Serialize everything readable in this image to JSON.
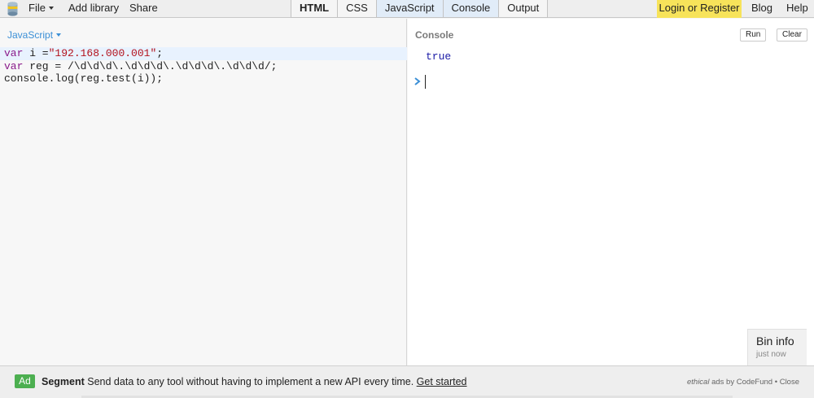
{
  "toolbar": {
    "menu": {
      "file": "File",
      "add_library": "Add library",
      "share": "Share"
    },
    "tabs": [
      {
        "label": "HTML",
        "active": false
      },
      {
        "label": "CSS",
        "active": false
      },
      {
        "label": "JavaScript",
        "active": true
      },
      {
        "label": "Console",
        "active": true
      },
      {
        "label": "Output",
        "active": false
      }
    ],
    "login": "Login or Register",
    "blog": "Blog",
    "help": "Help"
  },
  "editor": {
    "language": "JavaScript",
    "code": {
      "line1": {
        "kw": "var",
        "name": " i =",
        "str": "\"192.168.000.001\"",
        "end": ";"
      },
      "line2": {
        "kw": "var",
        "rest": " reg = /\\d\\d\\d\\.\\d\\d\\d\\.\\d\\d\\d\\.\\d\\d\\d/;"
      },
      "line3": "console.log(reg.test(i));"
    }
  },
  "console": {
    "title": "Console",
    "run": "Run",
    "clear": "Clear",
    "output": "true",
    "prompt_icon": "chevron-right-icon"
  },
  "bin_info": {
    "title": "Bin info",
    "time": "just now"
  },
  "ad": {
    "badge": "Ad",
    "brand": "Segment",
    "text": " Send data to any tool without having to implement a new API every time. ",
    "link": "Get started",
    "ethical": "ethical",
    "ads_by": " ads by CodeFund",
    "separator": " • ",
    "close": "Close"
  },
  "colors": {
    "accent": "#3b8fd6",
    "login_bg": "#f7e35a",
    "active_tab": "#e1ecf8",
    "ad_badge": "#4caf50"
  }
}
